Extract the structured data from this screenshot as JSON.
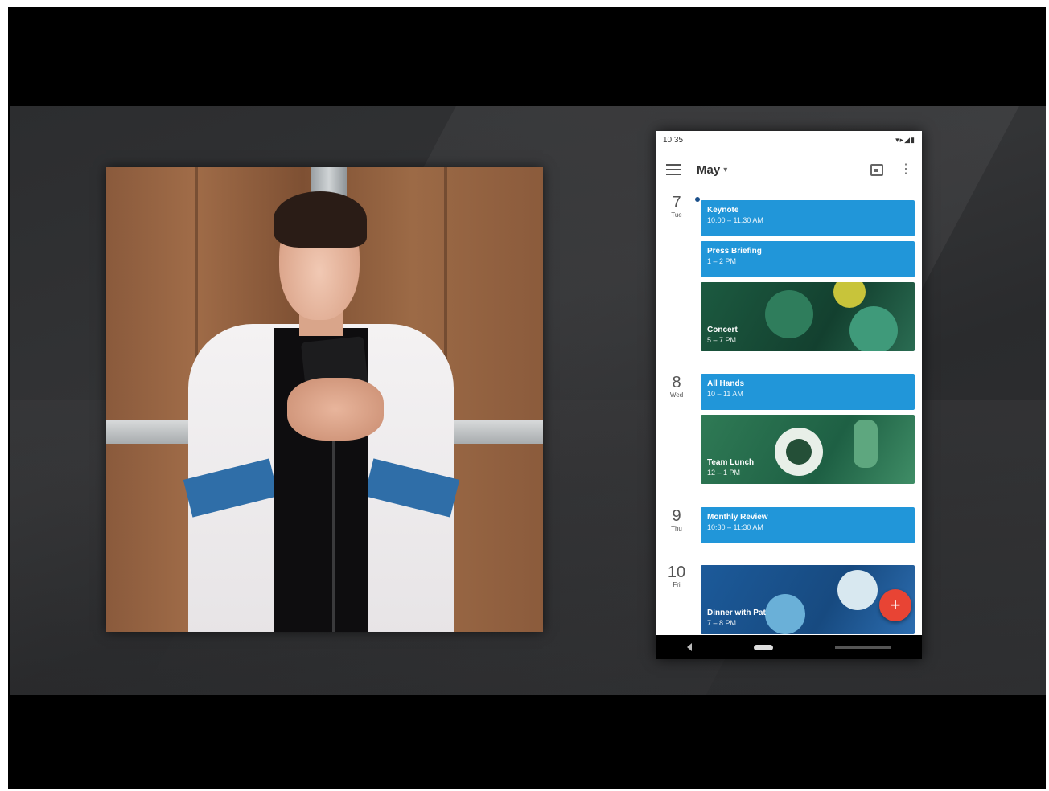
{
  "phone": {
    "status_time": "10:35",
    "status_icons": "▾▸◢▮",
    "month": "May",
    "month_caret": "▾",
    "more_glyph": "⋮",
    "fab_glyph": "+",
    "days": [
      {
        "num": "7",
        "dow": "Tue"
      },
      {
        "num": "8",
        "dow": "Wed"
      },
      {
        "num": "9",
        "dow": "Thu"
      },
      {
        "num": "10",
        "dow": "Fri"
      }
    ],
    "events": [
      {
        "title": "Keynote",
        "time": "10:00 – 11:30 AM"
      },
      {
        "title": "Press Briefing",
        "time": "1 – 2 PM"
      },
      {
        "title": "Concert",
        "time": "5 – 7 PM"
      },
      {
        "title": "All Hands",
        "time": "10 – 11 AM"
      },
      {
        "title": "Team Lunch",
        "time": "12 – 1 PM"
      },
      {
        "title": "Monthly Review",
        "time": "10:30 – 11:30 AM"
      },
      {
        "title": "Dinner with Pat",
        "time": "7 – 8 PM"
      }
    ]
  },
  "colors": {
    "event_blue": "#2196d9",
    "fab_red": "#e84434",
    "concert_green": "#1c5a40",
    "lunch_green": "#2f7a55",
    "dinner_blue": "#1c5a9a"
  }
}
